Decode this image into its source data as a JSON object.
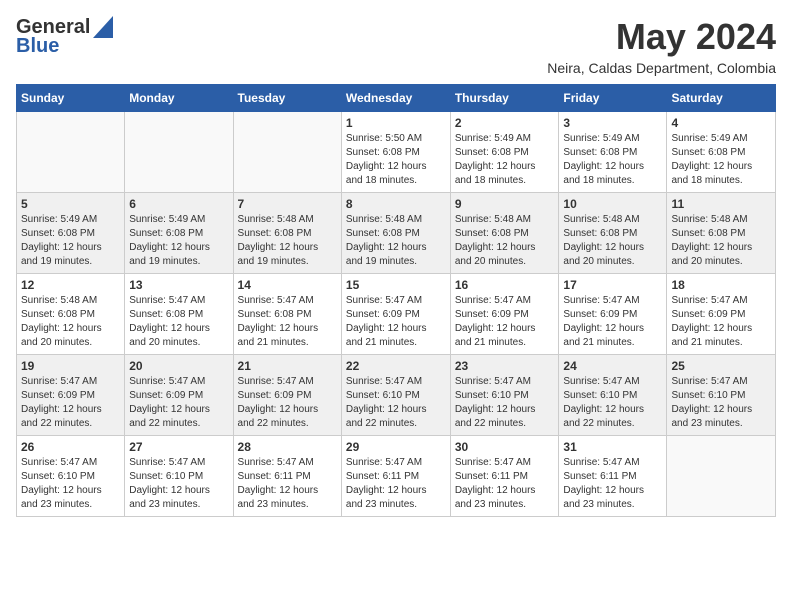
{
  "header": {
    "logo_general": "General",
    "logo_blue": "Blue",
    "title": "May 2024",
    "location": "Neira, Caldas Department, Colombia"
  },
  "calendar": {
    "days_of_week": [
      "Sunday",
      "Monday",
      "Tuesday",
      "Wednesday",
      "Thursday",
      "Friday",
      "Saturday"
    ],
    "weeks": [
      [
        {
          "day": "",
          "info": ""
        },
        {
          "day": "",
          "info": ""
        },
        {
          "day": "",
          "info": ""
        },
        {
          "day": "1",
          "info": "Sunrise: 5:50 AM\nSunset: 6:08 PM\nDaylight: 12 hours\nand 18 minutes."
        },
        {
          "day": "2",
          "info": "Sunrise: 5:49 AM\nSunset: 6:08 PM\nDaylight: 12 hours\nand 18 minutes."
        },
        {
          "day": "3",
          "info": "Sunrise: 5:49 AM\nSunset: 6:08 PM\nDaylight: 12 hours\nand 18 minutes."
        },
        {
          "day": "4",
          "info": "Sunrise: 5:49 AM\nSunset: 6:08 PM\nDaylight: 12 hours\nand 18 minutes."
        }
      ],
      [
        {
          "day": "5",
          "info": "Sunrise: 5:49 AM\nSunset: 6:08 PM\nDaylight: 12 hours\nand 19 minutes."
        },
        {
          "day": "6",
          "info": "Sunrise: 5:49 AM\nSunset: 6:08 PM\nDaylight: 12 hours\nand 19 minutes."
        },
        {
          "day": "7",
          "info": "Sunrise: 5:48 AM\nSunset: 6:08 PM\nDaylight: 12 hours\nand 19 minutes."
        },
        {
          "day": "8",
          "info": "Sunrise: 5:48 AM\nSunset: 6:08 PM\nDaylight: 12 hours\nand 19 minutes."
        },
        {
          "day": "9",
          "info": "Sunrise: 5:48 AM\nSunset: 6:08 PM\nDaylight: 12 hours\nand 20 minutes."
        },
        {
          "day": "10",
          "info": "Sunrise: 5:48 AM\nSunset: 6:08 PM\nDaylight: 12 hours\nand 20 minutes."
        },
        {
          "day": "11",
          "info": "Sunrise: 5:48 AM\nSunset: 6:08 PM\nDaylight: 12 hours\nand 20 minutes."
        }
      ],
      [
        {
          "day": "12",
          "info": "Sunrise: 5:48 AM\nSunset: 6:08 PM\nDaylight: 12 hours\nand 20 minutes."
        },
        {
          "day": "13",
          "info": "Sunrise: 5:47 AM\nSunset: 6:08 PM\nDaylight: 12 hours\nand 20 minutes."
        },
        {
          "day": "14",
          "info": "Sunrise: 5:47 AM\nSunset: 6:08 PM\nDaylight: 12 hours\nand 21 minutes."
        },
        {
          "day": "15",
          "info": "Sunrise: 5:47 AM\nSunset: 6:09 PM\nDaylight: 12 hours\nand 21 minutes."
        },
        {
          "day": "16",
          "info": "Sunrise: 5:47 AM\nSunset: 6:09 PM\nDaylight: 12 hours\nand 21 minutes."
        },
        {
          "day": "17",
          "info": "Sunrise: 5:47 AM\nSunset: 6:09 PM\nDaylight: 12 hours\nand 21 minutes."
        },
        {
          "day": "18",
          "info": "Sunrise: 5:47 AM\nSunset: 6:09 PM\nDaylight: 12 hours\nand 21 minutes."
        }
      ],
      [
        {
          "day": "19",
          "info": "Sunrise: 5:47 AM\nSunset: 6:09 PM\nDaylight: 12 hours\nand 22 minutes."
        },
        {
          "day": "20",
          "info": "Sunrise: 5:47 AM\nSunset: 6:09 PM\nDaylight: 12 hours\nand 22 minutes."
        },
        {
          "day": "21",
          "info": "Sunrise: 5:47 AM\nSunset: 6:09 PM\nDaylight: 12 hours\nand 22 minutes."
        },
        {
          "day": "22",
          "info": "Sunrise: 5:47 AM\nSunset: 6:10 PM\nDaylight: 12 hours\nand 22 minutes."
        },
        {
          "day": "23",
          "info": "Sunrise: 5:47 AM\nSunset: 6:10 PM\nDaylight: 12 hours\nand 22 minutes."
        },
        {
          "day": "24",
          "info": "Sunrise: 5:47 AM\nSunset: 6:10 PM\nDaylight: 12 hours\nand 22 minutes."
        },
        {
          "day": "25",
          "info": "Sunrise: 5:47 AM\nSunset: 6:10 PM\nDaylight: 12 hours\nand 23 minutes."
        }
      ],
      [
        {
          "day": "26",
          "info": "Sunrise: 5:47 AM\nSunset: 6:10 PM\nDaylight: 12 hours\nand 23 minutes."
        },
        {
          "day": "27",
          "info": "Sunrise: 5:47 AM\nSunset: 6:10 PM\nDaylight: 12 hours\nand 23 minutes."
        },
        {
          "day": "28",
          "info": "Sunrise: 5:47 AM\nSunset: 6:11 PM\nDaylight: 12 hours\nand 23 minutes."
        },
        {
          "day": "29",
          "info": "Sunrise: 5:47 AM\nSunset: 6:11 PM\nDaylight: 12 hours\nand 23 minutes."
        },
        {
          "day": "30",
          "info": "Sunrise: 5:47 AM\nSunset: 6:11 PM\nDaylight: 12 hours\nand 23 minutes."
        },
        {
          "day": "31",
          "info": "Sunrise: 5:47 AM\nSunset: 6:11 PM\nDaylight: 12 hours\nand 23 minutes."
        },
        {
          "day": "",
          "info": ""
        }
      ]
    ]
  }
}
